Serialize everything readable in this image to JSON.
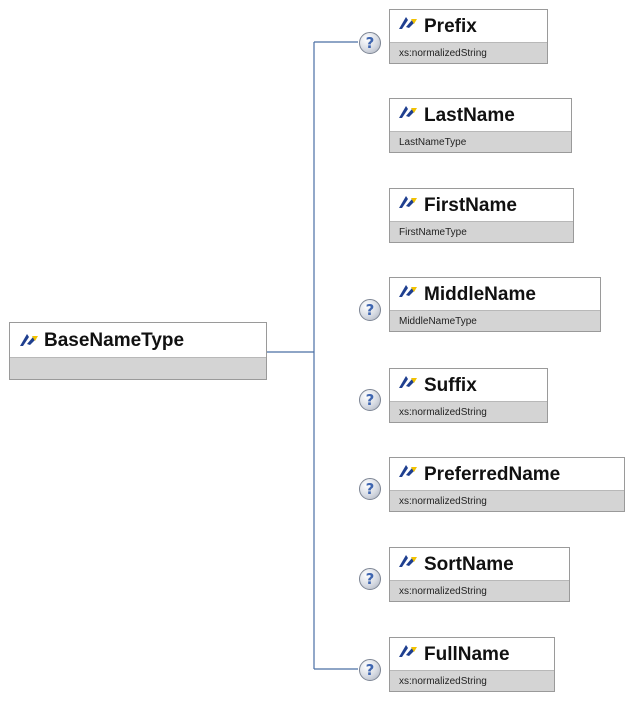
{
  "root": {
    "name": "BaseNameType"
  },
  "elements": [
    {
      "name": "Prefix",
      "type": "xs:normalizedString",
      "optional": true
    },
    {
      "name": "LastName",
      "type": "LastNameType",
      "optional": false
    },
    {
      "name": "FirstName",
      "type": "FirstNameType",
      "optional": false
    },
    {
      "name": "MiddleName",
      "type": "MiddleNameType",
      "optional": true
    },
    {
      "name": "Suffix",
      "type": "xs:normalizedString",
      "optional": true
    },
    {
      "name": "PreferredName",
      "type": "xs:normalizedString",
      "optional": true
    },
    {
      "name": "SortName",
      "type": "xs:normalizedString",
      "optional": true
    },
    {
      "name": "FullName",
      "type": "xs:normalizedString",
      "optional": true
    }
  ],
  "optional_marker": "?",
  "colors": {
    "connector": "#4a6fa5",
    "icon_blue": "#1f3f8f",
    "icon_yellow": "#f2c200",
    "footer_bg": "#d4d4d4",
    "border": "#9a9a9a"
  },
  "icons": {
    "type": "complex-type-icon",
    "optional": "question-circle-icon"
  }
}
